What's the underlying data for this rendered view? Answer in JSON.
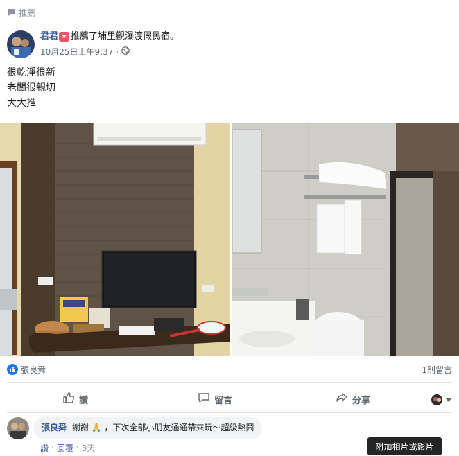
{
  "recommend": {
    "label": "推薦"
  },
  "post": {
    "author": "君君",
    "action": "推薦了埔里觀瀑渡假民宿。",
    "timestamp": "10月25日上午9:37",
    "body_lines": [
      "很乾淨很新",
      "老闆很親切",
      "大大推"
    ]
  },
  "photos": {
    "left_alt": "hotel-room-tv-wall-photo",
    "right_alt": "hotel-bathroom-photo"
  },
  "stats": {
    "liker": "張良舜",
    "comment_count": "1則留言"
  },
  "actions": {
    "like": "讚",
    "comment": "留言",
    "share": "分享"
  },
  "comment": {
    "author": "張良舜",
    "text_before": "謝謝",
    "text_after": "，下次全部小朋友通通帶來玩～超級熱鬧",
    "like": "讚",
    "reply": "回覆",
    "time": "3天"
  },
  "tooltip": {
    "text": "附加相片或影片"
  },
  "colors": {
    "link": "#365899",
    "like_blue": "#1877f2",
    "badge": "#f35369"
  }
}
